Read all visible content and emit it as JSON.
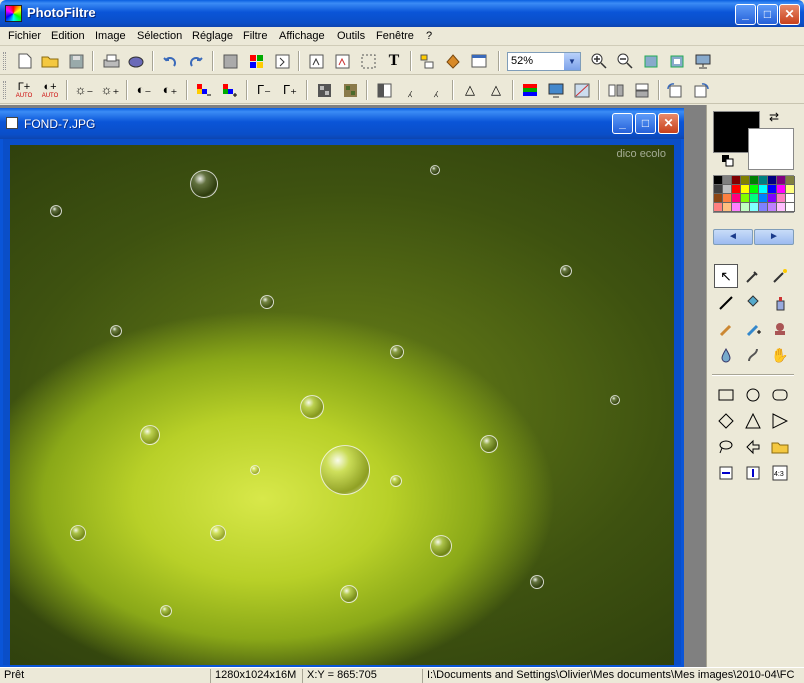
{
  "window": {
    "title": "PhotoFiltre",
    "minimize": "_",
    "maximize": "□",
    "close": "✕"
  },
  "menu": [
    "Fichier",
    "Edition",
    "Image",
    "Sélection",
    "Réglage",
    "Filtre",
    "Affichage",
    "Outils",
    "Fenêtre",
    "?"
  ],
  "toolbar": {
    "zoom_value": "52%",
    "zoom_arrow": "▼",
    "auto_label": "AUTO"
  },
  "document": {
    "title": "FOND-7.JPG",
    "watermark": "dico ecolo"
  },
  "palette": {
    "prev": "◄",
    "next": "►",
    "colors": [
      "#000000",
      "#808080",
      "#800000",
      "#808000",
      "#008000",
      "#008080",
      "#000080",
      "#800080",
      "#808040",
      "#404040",
      "#c0c0c0",
      "#ff0000",
      "#ffff00",
      "#00ff00",
      "#00ffff",
      "#0000ff",
      "#ff00ff",
      "#ffff80",
      "#8b4513",
      "#ff8040",
      "#ff0080",
      "#80ff00",
      "#00ff80",
      "#0080ff",
      "#8000ff",
      "#ff80c0",
      "#ffffff",
      "#ff8080",
      "#ffc080",
      "#ff80ff",
      "#c0ffc0",
      "#80ffff",
      "#8080ff",
      "#c080ff",
      "#ffc0ff",
      "#ffffff"
    ]
  },
  "status": {
    "state": "Prêt",
    "dimensions": "1280x1024x16M",
    "coords": "X:Y = 865:705",
    "path": "I:\\Documents and Settings\\Olivier\\Mes documents\\Mes images\\2010-04\\FC"
  }
}
